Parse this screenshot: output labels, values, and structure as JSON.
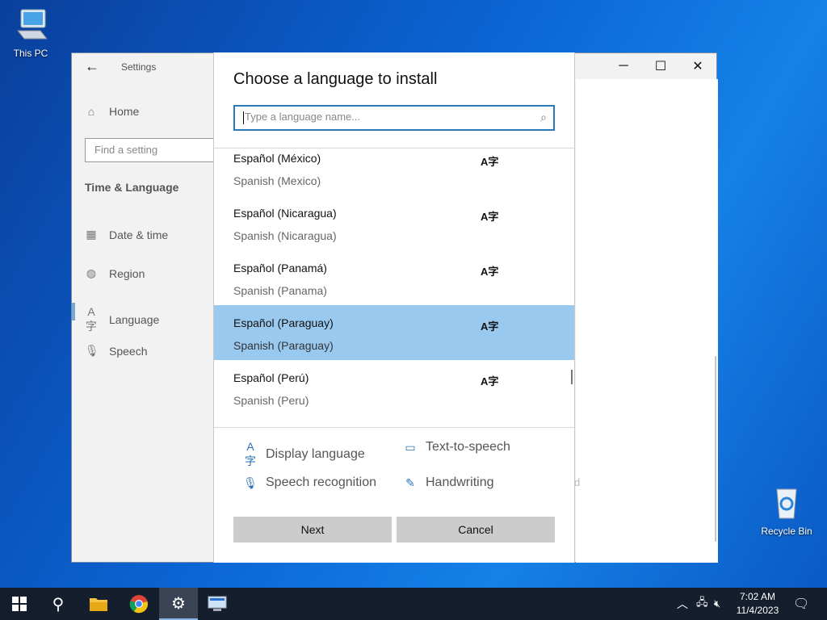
{
  "desktop": {
    "icons": [
      {
        "label": "This PC"
      },
      {
        "label": "Recycle Bin"
      }
    ]
  },
  "settings": {
    "app_title": "Settings",
    "nav_home": "Home",
    "search_placeholder": "Find a setting",
    "section_title": "Time & Language",
    "nav_items": [
      {
        "label": "Date & time",
        "icon": "calendar-icon"
      },
      {
        "label": "Region",
        "icon": "globe-icon"
      },
      {
        "label": "Language",
        "icon": "language-icon"
      },
      {
        "label": "Speech",
        "icon": "microphone-icon"
      }
    ],
    "behind_text": "d"
  },
  "dialog": {
    "title": "Choose a language to install",
    "search_placeholder": "Type a language name...",
    "languages": [
      {
        "native": "Español (México)",
        "english": "Spanish (Mexico)",
        "selected": false
      },
      {
        "native": "Español (Nicaragua)",
        "english": "Spanish (Nicaragua)",
        "selected": false
      },
      {
        "native": "Español (Panamá)",
        "english": "Spanish (Panama)",
        "selected": false
      },
      {
        "native": "Español (Paraguay)",
        "english": "Spanish (Paraguay)",
        "selected": true
      },
      {
        "native": "Español (Perú)",
        "english": "Spanish (Peru)",
        "selected": false
      }
    ],
    "features": [
      {
        "label": "Display language",
        "icon": "display-language-icon"
      },
      {
        "label": "Text-to-speech",
        "icon": "text-to-speech-icon"
      },
      {
        "label": "Speech recognition",
        "icon": "microphone-icon"
      },
      {
        "label": "Handwriting",
        "icon": "handwriting-icon"
      }
    ],
    "next_label": "Next",
    "cancel_label": "Cancel"
  },
  "taskbar": {
    "time": "7:02 AM",
    "date": "11/4/2023",
    "selected_color": "#99c9ef",
    "accent_color": "#2a7ab8"
  }
}
